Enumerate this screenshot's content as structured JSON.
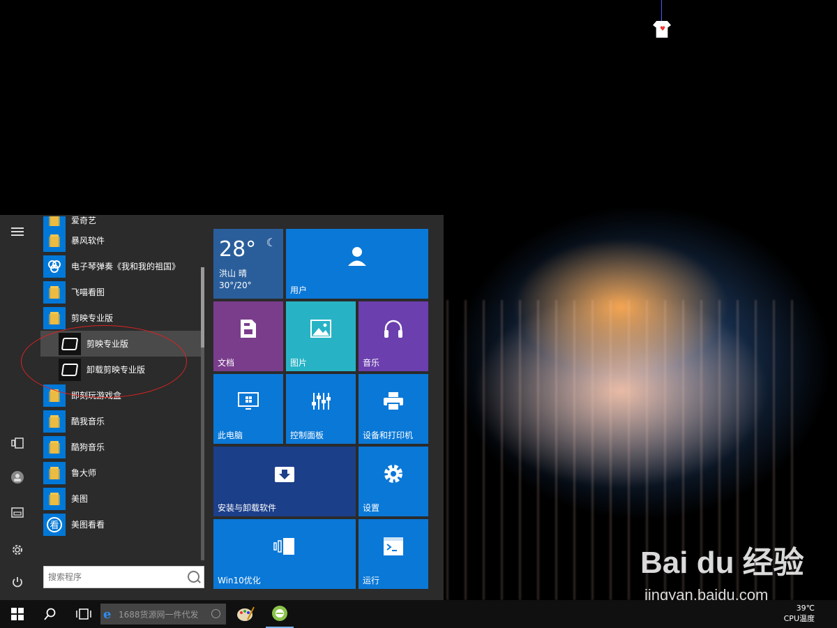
{
  "watermark": {
    "brand": "Bai du 经验",
    "url": "jingyan.baidu.com"
  },
  "start_menu": {
    "rail": {
      "items": [
        {
          "name": "expand-menu",
          "glyph": "☰"
        },
        {
          "name": "documents",
          "glyph": "▯"
        },
        {
          "name": "user-account",
          "glyph": "●"
        },
        {
          "name": "pictures",
          "glyph": "▣"
        },
        {
          "name": "settings",
          "glyph": "⚙"
        },
        {
          "name": "power",
          "glyph": "⏻"
        }
      ]
    },
    "apps": [
      {
        "label": "爱奇艺",
        "icon": "folder"
      },
      {
        "label": "暴风软件",
        "icon": "folder"
      },
      {
        "label": "电子琴弹奏《我和我的祖国》",
        "icon": "app"
      },
      {
        "label": "飞喵看图",
        "icon": "folder"
      },
      {
        "label": "剪映专业版",
        "icon": "folder"
      },
      {
        "label": "剪映专业版",
        "icon": "capcut",
        "sub": true,
        "selected": true
      },
      {
        "label": "卸载剪映专业版",
        "icon": "capcut",
        "sub": true
      },
      {
        "label": "即刻玩游戏盒",
        "icon": "folder"
      },
      {
        "label": "酷我音乐",
        "icon": "folder"
      },
      {
        "label": "酷狗音乐",
        "icon": "folder"
      },
      {
        "label": "鲁大师",
        "icon": "folder"
      },
      {
        "label": "美图",
        "icon": "folder"
      },
      {
        "label": "美图看看",
        "icon": "app"
      }
    ],
    "search": {
      "placeholder": "搜索程序"
    },
    "tiles": {
      "weather": {
        "temp": "28°",
        "city": "洪山 晴",
        "range": "30°/20°"
      },
      "user": "用户",
      "docs": "文档",
      "pictures": "图片",
      "music": "音乐",
      "this_pc": "此电脑",
      "control_panel": "控制面板",
      "devices_printers": "设备和打印机",
      "install_uninstall": "安装与卸载软件",
      "settings": "设置",
      "win10_optimize": "Win10优化",
      "run": "运行"
    },
    "colors": {
      "tile_blue": "#0a78d7",
      "tile_purple_docs": "#7a3d8c",
      "tile_teal": "#27b3c5",
      "tile_purple_music": "#6b3fae",
      "tile_navy": "#1c3f8a",
      "tile_weather": "#2a5e9b"
    }
  },
  "taskbar": {
    "search_placeholder": "1688货源网一件代发",
    "cpu_temp": "39℃",
    "cpu_label": "CPU温度"
  }
}
